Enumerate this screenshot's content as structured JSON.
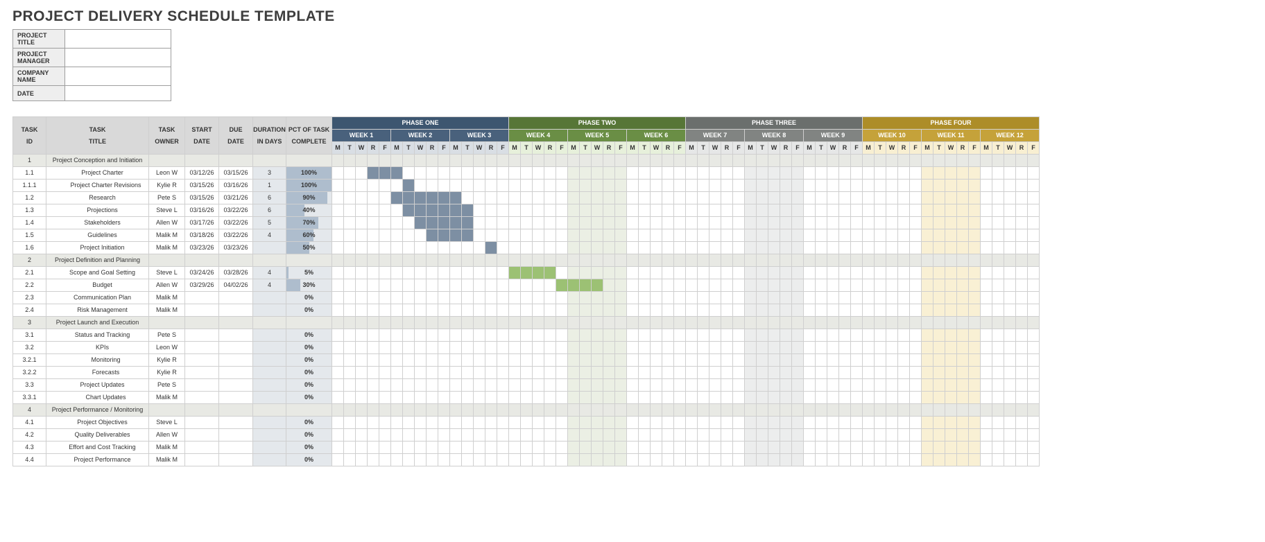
{
  "title": "PROJECT DELIVERY SCHEDULE TEMPLATE",
  "meta_labels": {
    "project_title": "PROJECT TITLE",
    "project_manager": "PROJECT MANAGER",
    "company_name": "COMPANY NAME",
    "date": "DATE"
  },
  "meta_values": {
    "project_title": "",
    "project_manager": "",
    "company_name": "",
    "date": ""
  },
  "columns": {
    "task_id": "TASK ID",
    "task_title": "TASK TITLE",
    "task_owner": "TASK OWNER",
    "start_date": "START DATE",
    "due_date": "DUE DATE",
    "duration": "DURATION IN DAYS",
    "pct": "PCT OF TASK COMPLETE"
  },
  "phases": [
    {
      "name": "PHASE ONE",
      "weeks": [
        "WEEK 1",
        "WEEK 2",
        "WEEK 3"
      ],
      "key": 1
    },
    {
      "name": "PHASE TWO",
      "weeks": [
        "WEEK 4",
        "WEEK 5",
        "WEEK 6"
      ],
      "key": 2
    },
    {
      "name": "PHASE THREE",
      "weeks": [
        "WEEK 7",
        "WEEK 8",
        "WEEK 9"
      ],
      "key": 3
    },
    {
      "name": "PHASE FOUR",
      "weeks": [
        "WEEK 10",
        "WEEK 11",
        "WEEK 12"
      ],
      "key": 4
    }
  ],
  "days": [
    "M",
    "T",
    "W",
    "R",
    "F"
  ],
  "rows": [
    {
      "id": "1",
      "title": "Project Conception and Initiation",
      "section": true
    },
    {
      "id": "1.1",
      "title": "Project Charter",
      "owner": "Leon W",
      "start": "03/12/26",
      "due": "03/15/26",
      "dur": "3",
      "pct": 100,
      "indent": 1,
      "bar": {
        "phase": 1,
        "from": 4,
        "to": 6
      }
    },
    {
      "id": "1.1.1",
      "title": "Project Charter Revisions",
      "owner": "Kylie R",
      "start": "03/15/26",
      "due": "03/16/26",
      "dur": "1",
      "pct": 100,
      "indent": 2,
      "bar": {
        "phase": 1,
        "from": 7,
        "to": 7
      }
    },
    {
      "id": "1.2",
      "title": "Research",
      "owner": "Pete S",
      "start": "03/15/26",
      "due": "03/21/26",
      "dur": "6",
      "pct": 90,
      "indent": 1,
      "bar": {
        "phase": 1,
        "from": 6,
        "to": 11
      }
    },
    {
      "id": "1.3",
      "title": "Projections",
      "owner": "Steve L",
      "start": "03/16/26",
      "due": "03/22/26",
      "dur": "6",
      "pct": 40,
      "indent": 1,
      "bar": {
        "phase": 1,
        "from": 7,
        "to": 12
      }
    },
    {
      "id": "1.4",
      "title": "Stakeholders",
      "owner": "Allen W",
      "start": "03/17/26",
      "due": "03/22/26",
      "dur": "5",
      "pct": 70,
      "indent": 1,
      "bar": {
        "phase": 1,
        "from": 8,
        "to": 12
      }
    },
    {
      "id": "1.5",
      "title": "Guidelines",
      "owner": "Malik M",
      "start": "03/18/26",
      "due": "03/22/26",
      "dur": "4",
      "pct": 60,
      "indent": 1,
      "bar": {
        "phase": 1,
        "from": 9,
        "to": 12
      }
    },
    {
      "id": "1.6",
      "title": "Project Initiation",
      "owner": "Malik M",
      "start": "03/23/26",
      "due": "03/23/26",
      "dur": "",
      "pct": 50,
      "indent": 1,
      "bar": {
        "phase": 1,
        "from": 14,
        "to": 14
      }
    },
    {
      "id": "2",
      "title": "Project Definition and Planning",
      "section": true
    },
    {
      "id": "2.1",
      "title": "Scope and Goal Setting",
      "owner": "Steve L",
      "start": "03/24/26",
      "due": "03/28/26",
      "dur": "4",
      "pct": 5,
      "indent": 1,
      "bar": {
        "phase": 2,
        "from": 16,
        "to": 19
      }
    },
    {
      "id": "2.2",
      "title": "Budget",
      "owner": "Allen W",
      "start": "03/29/26",
      "due": "04/02/26",
      "dur": "4",
      "pct": 30,
      "indent": 1,
      "bar": {
        "phase": 2,
        "from": 20,
        "to": 23
      }
    },
    {
      "id": "2.3",
      "title": "Communication Plan",
      "owner": "Malik M",
      "start": "",
      "due": "",
      "dur": "",
      "pct": 0,
      "indent": 1
    },
    {
      "id": "2.4",
      "title": "Risk Management",
      "owner": "Malik M",
      "start": "",
      "due": "",
      "dur": "",
      "pct": 0,
      "indent": 1
    },
    {
      "id": "3",
      "title": "Project Launch and Execution",
      "section": true
    },
    {
      "id": "3.1",
      "title": "Status and Tracking",
      "owner": "Pete S",
      "start": "",
      "due": "",
      "dur": "",
      "pct": 0,
      "indent": 1
    },
    {
      "id": "3.2",
      "title": "KPIs",
      "owner": "Leon W",
      "start": "",
      "due": "",
      "dur": "",
      "pct": 0,
      "indent": 1
    },
    {
      "id": "3.2.1",
      "title": "Monitoring",
      "owner": "Kylie R",
      "start": "",
      "due": "",
      "dur": "",
      "pct": 0,
      "indent": 2
    },
    {
      "id": "3.2.2",
      "title": "Forecasts",
      "owner": "Kylie R",
      "start": "",
      "due": "",
      "dur": "",
      "pct": 0,
      "indent": 2
    },
    {
      "id": "3.3",
      "title": "Project Updates",
      "owner": "Pete S",
      "start": "",
      "due": "",
      "dur": "",
      "pct": 0,
      "indent": 1
    },
    {
      "id": "3.3.1",
      "title": "Chart Updates",
      "owner": "Malik M",
      "start": "",
      "due": "",
      "dur": "",
      "pct": 0,
      "indent": 2
    },
    {
      "id": "4",
      "title": "Project Performance / Monitoring",
      "section": true
    },
    {
      "id": "4.1",
      "title": "Project Objectives",
      "owner": "Steve L",
      "start": "",
      "due": "",
      "dur": "",
      "pct": 0,
      "indent": 1
    },
    {
      "id": "4.2",
      "title": "Quality Deliverables",
      "owner": "Allen W",
      "start": "",
      "due": "",
      "dur": "",
      "pct": 0,
      "indent": 1
    },
    {
      "id": "4.3",
      "title": "Effort and Cost Tracking",
      "owner": "Malik M",
      "start": "",
      "due": "",
      "dur": "",
      "pct": 0,
      "indent": 1
    },
    {
      "id": "4.4",
      "title": "Project Performance",
      "owner": "Malik M",
      "start": "",
      "due": "",
      "dur": "",
      "pct": 0,
      "indent": 1
    }
  ],
  "shaded_weeks": {
    "2": [
      5
    ],
    "3": [
      8
    ],
    "4": [
      11
    ]
  }
}
